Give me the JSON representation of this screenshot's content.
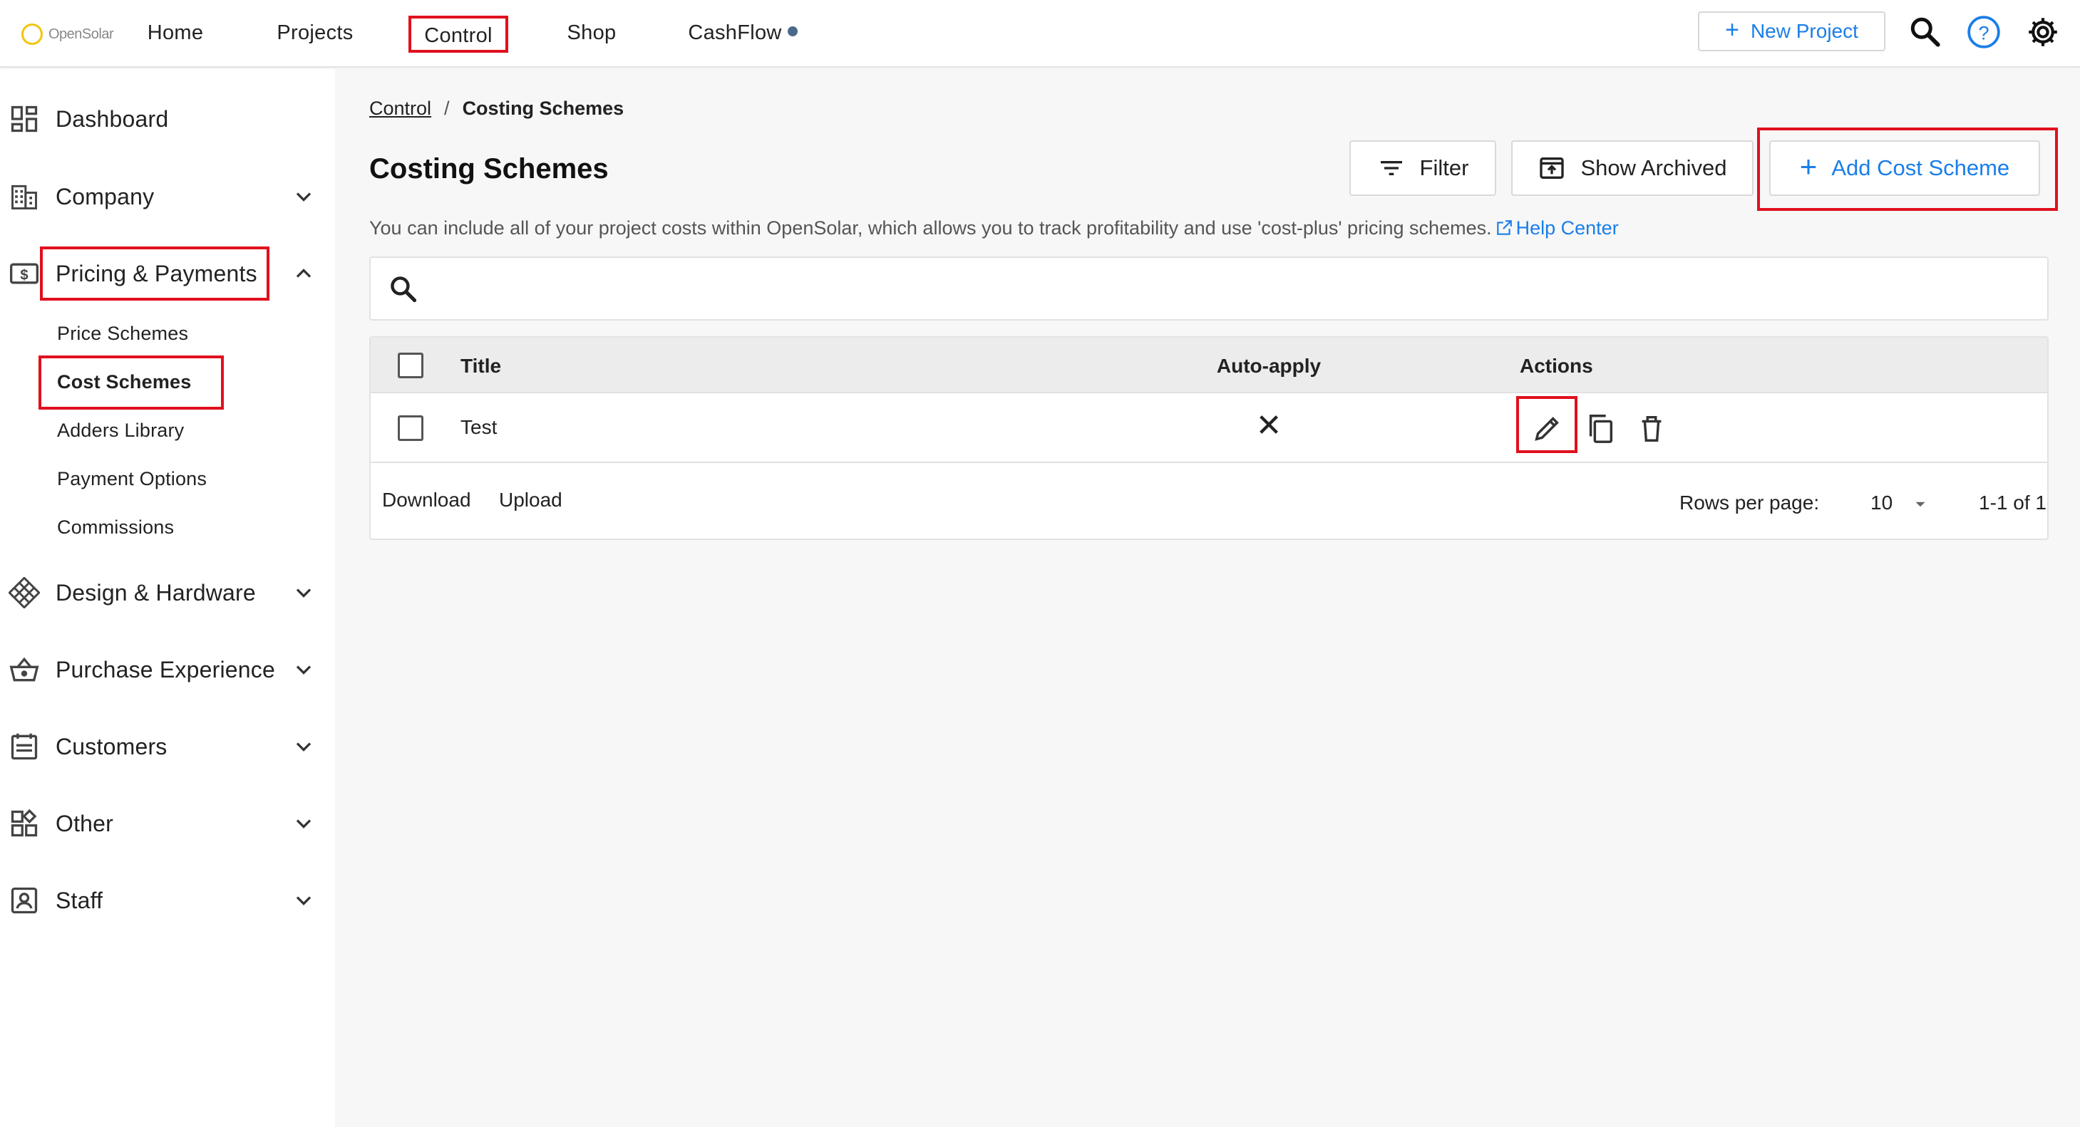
{
  "app": {
    "logo_text": "OpenSolar"
  },
  "nav": {
    "items": [
      {
        "label": "Home"
      },
      {
        "label": "Projects"
      },
      {
        "label": "Control"
      },
      {
        "label": "Shop"
      },
      {
        "label": "CashFlow"
      }
    ],
    "new_project_label": "New Project"
  },
  "sidebar": {
    "items": [
      {
        "label": "Dashboard",
        "icon": "dashboard-icon"
      },
      {
        "label": "Company",
        "icon": "building-icon"
      },
      {
        "label": "Pricing & Payments",
        "icon": "dollar-icon"
      },
      {
        "label": "Design & Hardware",
        "icon": "grid-diamond-icon"
      },
      {
        "label": "Purchase Experience",
        "icon": "basket-icon"
      },
      {
        "label": "Customers",
        "icon": "list-icon"
      },
      {
        "label": "Other",
        "icon": "widgets-icon"
      },
      {
        "label": "Staff",
        "icon": "badge-icon"
      }
    ],
    "subitems": [
      {
        "label": "Price Schemes"
      },
      {
        "label": "Cost Schemes"
      },
      {
        "label": "Adders Library"
      },
      {
        "label": "Payment Options"
      },
      {
        "label": "Commissions"
      }
    ]
  },
  "main": {
    "breadcrumb": {
      "root": "Control",
      "separator": "/",
      "current": "Costing Schemes"
    },
    "title": "Costing Schemes",
    "buttons": {
      "filter": "Filter",
      "show_archived": "Show Archived",
      "add": "Add Cost Scheme"
    },
    "description": "You can include all of your project costs within OpenSolar, which allows you to track profitability and use 'cost-plus' pricing schemes.",
    "help_label": "Help Center",
    "table": {
      "columns": [
        "Title",
        "Auto-apply",
        "Actions"
      ],
      "rows": [
        {
          "title": "Test",
          "auto_apply": "✕"
        }
      ],
      "footer": {
        "download": "Download",
        "upload": "Upload",
        "rows_per_page_label": "Rows per page:",
        "rows_per_page_value": "10",
        "range": "1-1 of 1"
      }
    }
  },
  "colors": {
    "accent": "#1a7ee8",
    "highlight": "#e0101d",
    "logo": "#f2c40f"
  }
}
